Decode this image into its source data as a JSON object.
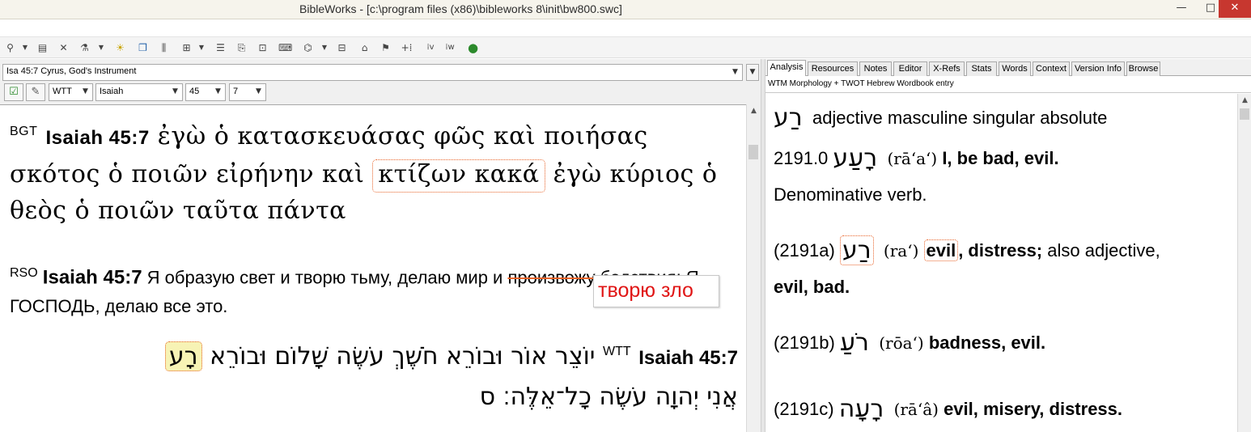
{
  "window": {
    "title": "BibleWorks - [c:\\program files (x86)\\bibleworks 8\\init\\bw800.swc]",
    "min_glyph": "—",
    "max_glyph": "□",
    "close_glyph": "✕"
  },
  "toolbar_icons": [
    "search-icon",
    "dropdown-arrow",
    "database-icon",
    "tools-icon",
    "flask-icon",
    "dropdown-arrow",
    "bulb-icon",
    "windows-icon",
    "split-icon",
    "grid-icon",
    "dropdown-arrow",
    "list-icon",
    "copy-icon",
    "folder-icon",
    "keyboard-icon",
    "flowchart-icon",
    "dropdown-arrow",
    "map-icon",
    "stamp-icon",
    "plus-i-icon",
    "ev-icon",
    "ew-icon",
    "globe-icon"
  ],
  "left": {
    "reference_combo": "Isa 45:7 Cyrus, God's Instrument",
    "selectors": {
      "version": "WTT",
      "book": "Isaiah",
      "chapter": "45",
      "verse": "7"
    },
    "bgt": {
      "tag": "BGT",
      "ref": "Isaiah 45:7",
      "text_1": "ἐγὼ ὁ κατασκευάσας φῶς καὶ ποιήσας σκότος ὁ ποιῶν εἰρήνην καὶ",
      "text_hl": "κτίζων κακά",
      "text_2": "ἐγὼ κύριος ὁ θεὸς ὁ ποιῶν ταῦτα πάντα"
    },
    "rso": {
      "tag": "RSO",
      "ref": "Isaiah 45:7",
      "text_1": "Я образую свет и творю тьму, делаю мир и",
      "text_struck": "произвожу бедствия",
      "text_2": "; Я, ГОСПОДЬ, делаю все это."
    },
    "annotation": "творю зло",
    "wtt": {
      "tag": "WTT",
      "ref": "Isaiah 45:7",
      "line1_text": "יוֹצֵר אוֹר וּבוֹרֵא חֹשֶׁךְ עֹשֶׂה שָׁלוֹם וּבוֹרֵא",
      "line1_hl": "רָע",
      "line2_text": "אֲנִי יְהוָה עֹשֶׂה כָל־אֵלֶּה׃ ס"
    }
  },
  "right": {
    "tabs": [
      "Analysis",
      "Resources",
      "Notes",
      "Editor",
      "X-Refs",
      "Stats",
      "Words",
      "Context",
      "Version Info",
      "Browse"
    ],
    "active_tab": "Analysis",
    "subheader": "WTM Morphology + TWOT Hebrew Wordbook entry",
    "analysis": {
      "word": "רַע",
      "parse": "adjective masculine singular absolute",
      "e1_num": "2191.0",
      "e1_heb": "רָעַע",
      "e1_translit": "(rā‘a‘)",
      "e1_gloss": "I, be bad, evil.",
      "e1_note": "Denominative verb.",
      "e2_num": "(2191a)",
      "e2_heb": "רַע",
      "e2_translit": "(ra‘)",
      "e2_gloss_hl": "evil",
      "e2_gloss": ", distress;",
      "e2_also": "also adjective,",
      "e2_gloss2": "evil, bad.",
      "e3_num": "(2191b)",
      "e3_heb": "רֹעַ",
      "e3_translit": "(rōa‘)",
      "e3_gloss": "badness, evil.",
      "e4_num": "(2191c)",
      "e4_heb": "רָעָה",
      "e4_translit": "(rā‘â)",
      "e4_gloss": "evil, misery, distress."
    }
  }
}
